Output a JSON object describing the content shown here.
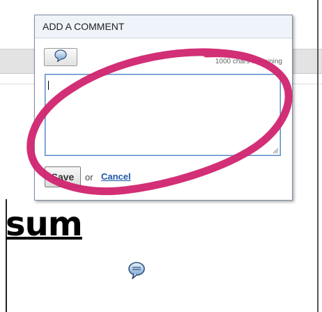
{
  "dialog": {
    "title": "ADD A COMMENT",
    "chars_remaining": "1000 chars remaining",
    "textarea_value": "",
    "save_label": "Save",
    "or_text": "or",
    "cancel_label": "Cancel",
    "icons": {
      "insert": "comment-bubble-icon"
    }
  },
  "page": {
    "heading_fragment": "sum",
    "inline_icon": "comment-bubble-icon"
  },
  "colors": {
    "dialog_border": "#7f8da3",
    "textarea_focus_border": "#5a89c6",
    "link": "#1d56a6",
    "annotation": "#d0246f"
  }
}
